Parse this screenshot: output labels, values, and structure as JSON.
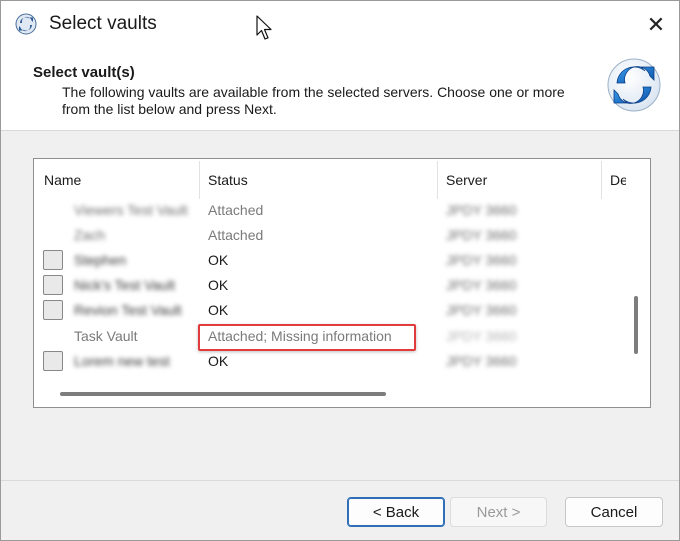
{
  "window": {
    "title": "Select vaults",
    "close_glyph": "✕"
  },
  "header": {
    "title": "Select vault(s)",
    "description": "The following vaults are available from the selected servers. Choose one or more from the list below and press Next.",
    "logo_icon": "sync-arrows-icon"
  },
  "list": {
    "columns": [
      "Name",
      "Status",
      "Server",
      "De"
    ],
    "rows": [
      {
        "name": "Viewers Test Vault",
        "status": "Attached",
        "server": "JPDY 3660",
        "checkbox": false,
        "name_blurred": true
      },
      {
        "name": "Zach",
        "status": "Attached",
        "server": "JPDY 3660",
        "checkbox": false,
        "name_blurred": true
      },
      {
        "name": "Stephen",
        "status": "OK",
        "server": "JPDY 3660",
        "checkbox": true,
        "name_blurred": true
      },
      {
        "name": "Nick's Test Vault",
        "status": "OK",
        "server": "JPDY 3660",
        "checkbox": true,
        "name_blurred": true
      },
      {
        "name": "Revion Test Vault",
        "status": "OK",
        "server": "JPDY 3660",
        "checkbox": true,
        "name_blurred": true
      },
      {
        "name": "Task Vault",
        "status": "Attached; Missing information",
        "server": "JPDY 3660",
        "checkbox": false,
        "name_blurred": false
      },
      {
        "name": "Lorem new test",
        "status": "OK",
        "server": "JPDY 3660",
        "checkbox": true,
        "name_blurred": true
      }
    ]
  },
  "buttons": {
    "back": "< Back",
    "next": "Next >",
    "cancel": "Cancel"
  },
  "colors": {
    "highlight_border": "#e23b3b",
    "primary_border": "#2f6fb8"
  }
}
